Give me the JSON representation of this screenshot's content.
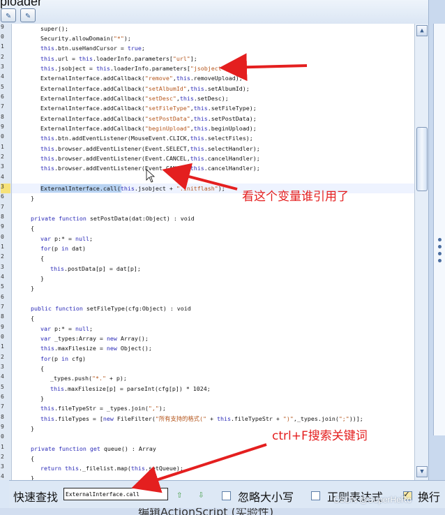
{
  "window": {
    "title": "ploader"
  },
  "editor": {
    "line_numbers": [
      "9",
      "0",
      "1",
      "2",
      "3",
      "4",
      "5",
      "6",
      "7",
      "8",
      "9",
      "0",
      "1",
      "2",
      "3",
      "4",
      "5",
      "6",
      "7",
      "8",
      "9",
      "0",
      "1",
      "2",
      "3",
      "4",
      "5",
      "6",
      "7",
      "8",
      "9",
      "0",
      "1",
      "2",
      "3",
      "4",
      "5",
      "6",
      "7",
      "8",
      "9",
      "0",
      "1",
      "2",
      "3",
      "4",
      "5"
    ],
    "current_line_label": "3"
  },
  "find_bar": {
    "label": "快速查找",
    "query": "ExternalInterface.call",
    "options": [
      {
        "label": "忽略大小写",
        "checked": false
      },
      {
        "label": "正则表达式",
        "checked": false
      },
      {
        "label": "换行",
        "checked": true
      }
    ]
  },
  "annotations": {
    "variable_note": "看这个变量谁引用了",
    "search_note": "ctrl+F搜索关键词",
    "annotation_color": "#e41f1f"
  },
  "bottom_tab": "编辑ActionScript (实验性)",
  "watermark": "CSDN @SuperHeRo",
  "icons": [
    "toolbar-button-1",
    "toolbar-button-2",
    "scroll-up-icon",
    "scroll-down-icon",
    "arrow-up-icon",
    "arrow-down-icon"
  ]
}
